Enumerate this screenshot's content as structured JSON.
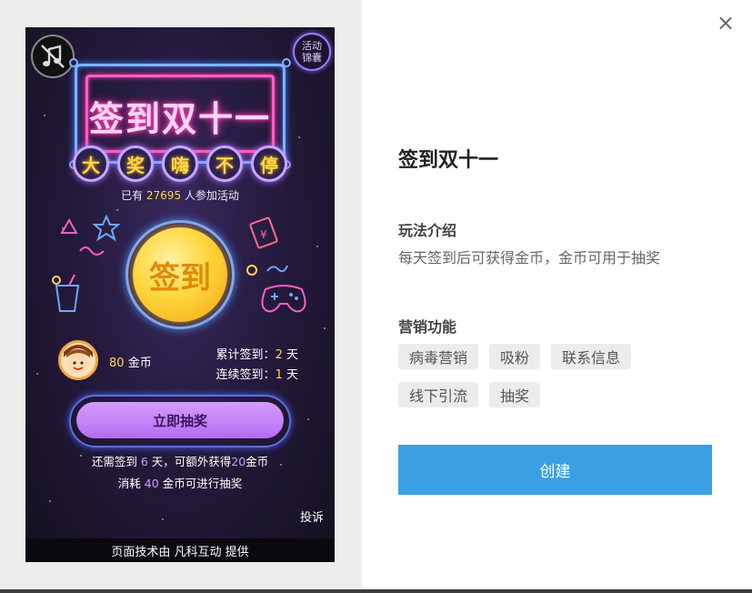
{
  "preview": {
    "activity_badge": "活动锦囊",
    "title": "签到双十一",
    "slogan_chars": [
      "大",
      "奖",
      "嗨",
      "不",
      "停"
    ],
    "participants_prefix": "已有",
    "participants_count": "27695",
    "participants_suffix": "人参加活动",
    "coin_label": "签到",
    "user_coins": "80",
    "user_coins_unit": "金币",
    "total_signin_label": "累计签到：",
    "total_signin_value": "2",
    "continuous_signin_label": "连续签到：",
    "continuous_signin_value": "1",
    "day_unit": "天",
    "draw_button": "立即抽奖",
    "info_line1_a": "还需签到",
    "info_line1_days": "6",
    "info_line1_b": "天，可额外获得",
    "info_line1_coins": "20",
    "info_line1_c": "金币",
    "info_line2_a": "消耗",
    "info_line2_coins": "40",
    "info_line2_b": "金币可进行抽奖",
    "report": "投诉",
    "footer": "页面技术由 凡科互动 提供"
  },
  "panel": {
    "close_icon": "×",
    "title": "签到双十一",
    "gameplay_heading": "玩法介绍",
    "gameplay_desc": "每天签到后可获得金币，金币可用于抽奖",
    "marketing_heading": "营销功能",
    "tags": [
      "病毒营销",
      "吸粉",
      "联系信息",
      "线下引流",
      "抽奖"
    ],
    "create_button": "创建"
  },
  "colors": {
    "accent_blue": "#3aa0e3",
    "neon_pink": "#ff5ec8",
    "neon_blue": "#7fb3ff",
    "coin_gold": "#ffd63c",
    "highlight_yellow": "#ffd84a",
    "highlight_purple": "#d49bff"
  },
  "icons": [
    "music-muted-icon",
    "close-icon",
    "star-icon",
    "red-envelope-icon",
    "drink-icon",
    "gamepad-icon"
  ]
}
